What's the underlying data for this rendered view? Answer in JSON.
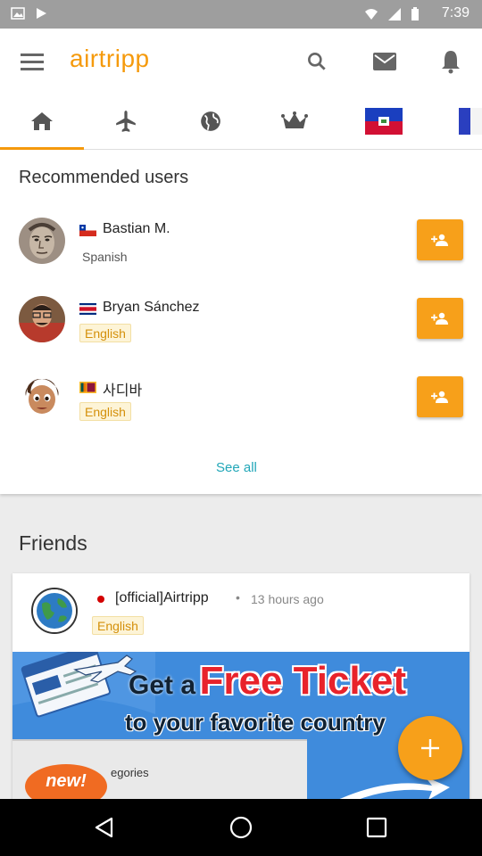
{
  "status_bar": {
    "time": "7:39"
  },
  "app": {
    "title": "airtripp",
    "brand_color": "#f59a0c",
    "accent_teal": "#22a7b8"
  },
  "app_bar": {
    "menu_icon": "hamburger-menu-icon",
    "actions": [
      "search-icon",
      "mail-icon",
      "notification-bell-icon"
    ]
  },
  "tabs": [
    {
      "icon": "home-icon",
      "active": true
    },
    {
      "icon": "airplane-icon",
      "active": false
    },
    {
      "icon": "globe-icon",
      "active": false
    },
    {
      "icon": "crown-icon",
      "active": false
    },
    {
      "icon": "haiti-flag-icon",
      "active": false
    },
    {
      "icon": "france-flag-icon",
      "active": false
    }
  ],
  "recommended": {
    "title": "Recommended users",
    "users": [
      {
        "name": "Bastian M.",
        "language": "Spanish",
        "flag": "chile-flag-icon",
        "highlighted": false
      },
      {
        "name": "Bryan Sánchez",
        "language": "English",
        "flag": "costa-rica-flag-icon",
        "highlighted": true
      },
      {
        "name": "사디바",
        "language": "English",
        "flag": "sri-lanka-flag-icon",
        "highlighted": true
      }
    ],
    "see_all": "See all"
  },
  "friends": {
    "title": "Friends",
    "post": {
      "name": "[official]Airtripp",
      "separator": "•",
      "time": "13 hours ago",
      "language": "English",
      "flag": "japan-flag-icon",
      "banner": {
        "get_a": "Get a",
        "free_ticket": "Free Ticket",
        "line2": "to your favorite country",
        "new_badge": "new!",
        "categories": "egories"
      }
    }
  },
  "fab_icon": "plus-icon",
  "nav": [
    "back-icon",
    "home-circle-icon",
    "recents-icon"
  ]
}
